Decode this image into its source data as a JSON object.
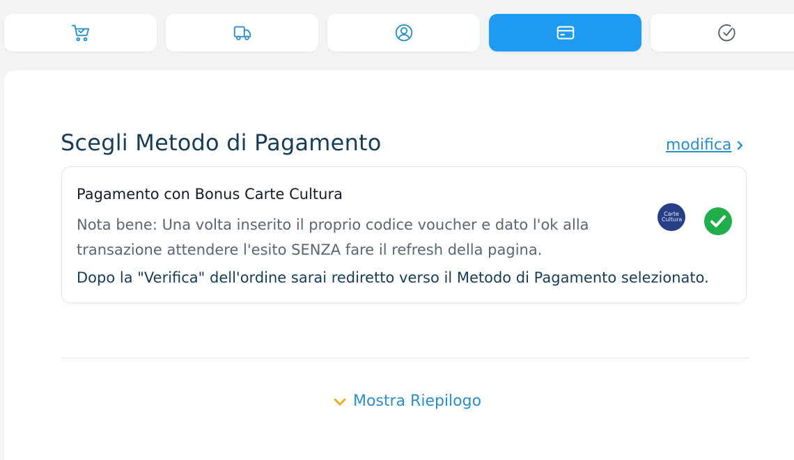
{
  "steps": [
    {
      "icon": "cart-check-icon",
      "active": false
    },
    {
      "icon": "truck-icon",
      "active": false
    },
    {
      "icon": "user-circle-icon",
      "active": false
    },
    {
      "icon": "credit-card-icon",
      "active": true
    },
    {
      "icon": "check-circle-icon",
      "active": false
    }
  ],
  "colors": {
    "accent": "#1e9bf0",
    "title": "#173c55",
    "link": "#2a8fc9",
    "success": "#1fae4b",
    "chevron_toggle": "#f0ad1c"
  },
  "section": {
    "title": "Scegli Metodo di Pagamento",
    "modify_label": "modifica"
  },
  "payment": {
    "title": "Pagamento con Bonus Carte Cultura",
    "note": "Nota bene: Una volta inserito il proprio codice voucher e dato l'ok alla transazione attendere l'esito SENZA fare il refresh della pagina.",
    "redirect": "Dopo la \"Verifica\" dell'ordine sarai rediretto verso il Metodo di Pagamento selezionato.",
    "logo_text": "Carte Cultura",
    "selected": true
  },
  "summary": {
    "toggle_label": "Mostra Riepilogo"
  }
}
